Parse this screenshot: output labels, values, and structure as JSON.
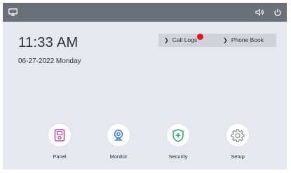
{
  "clock": {
    "time": "11:33 AM",
    "date": "06-27-2022 Monday"
  },
  "quick_links": [
    {
      "label": "Call Logs",
      "icon": "chevron-right-icon",
      "has_notification": true
    },
    {
      "label": "Phone Book",
      "icon": "chevron-right-icon"
    }
  ],
  "apps": [
    {
      "label": "Panel",
      "icon": "panel-icon"
    },
    {
      "label": "Monitor",
      "icon": "camera-icon"
    },
    {
      "label": "Security",
      "icon": "shield-plus-icon"
    },
    {
      "label": "Setup",
      "icon": "gear-icon"
    }
  ],
  "colors": {
    "background": "#e5e8ef",
    "topbar": "#6b6f78",
    "panel_accent": "#b04aa8",
    "monitor_accent": "#3b7bd8",
    "security_accent": "#2ea86a",
    "setup_accent": "#8c8f96",
    "notification": "#e0161b"
  }
}
